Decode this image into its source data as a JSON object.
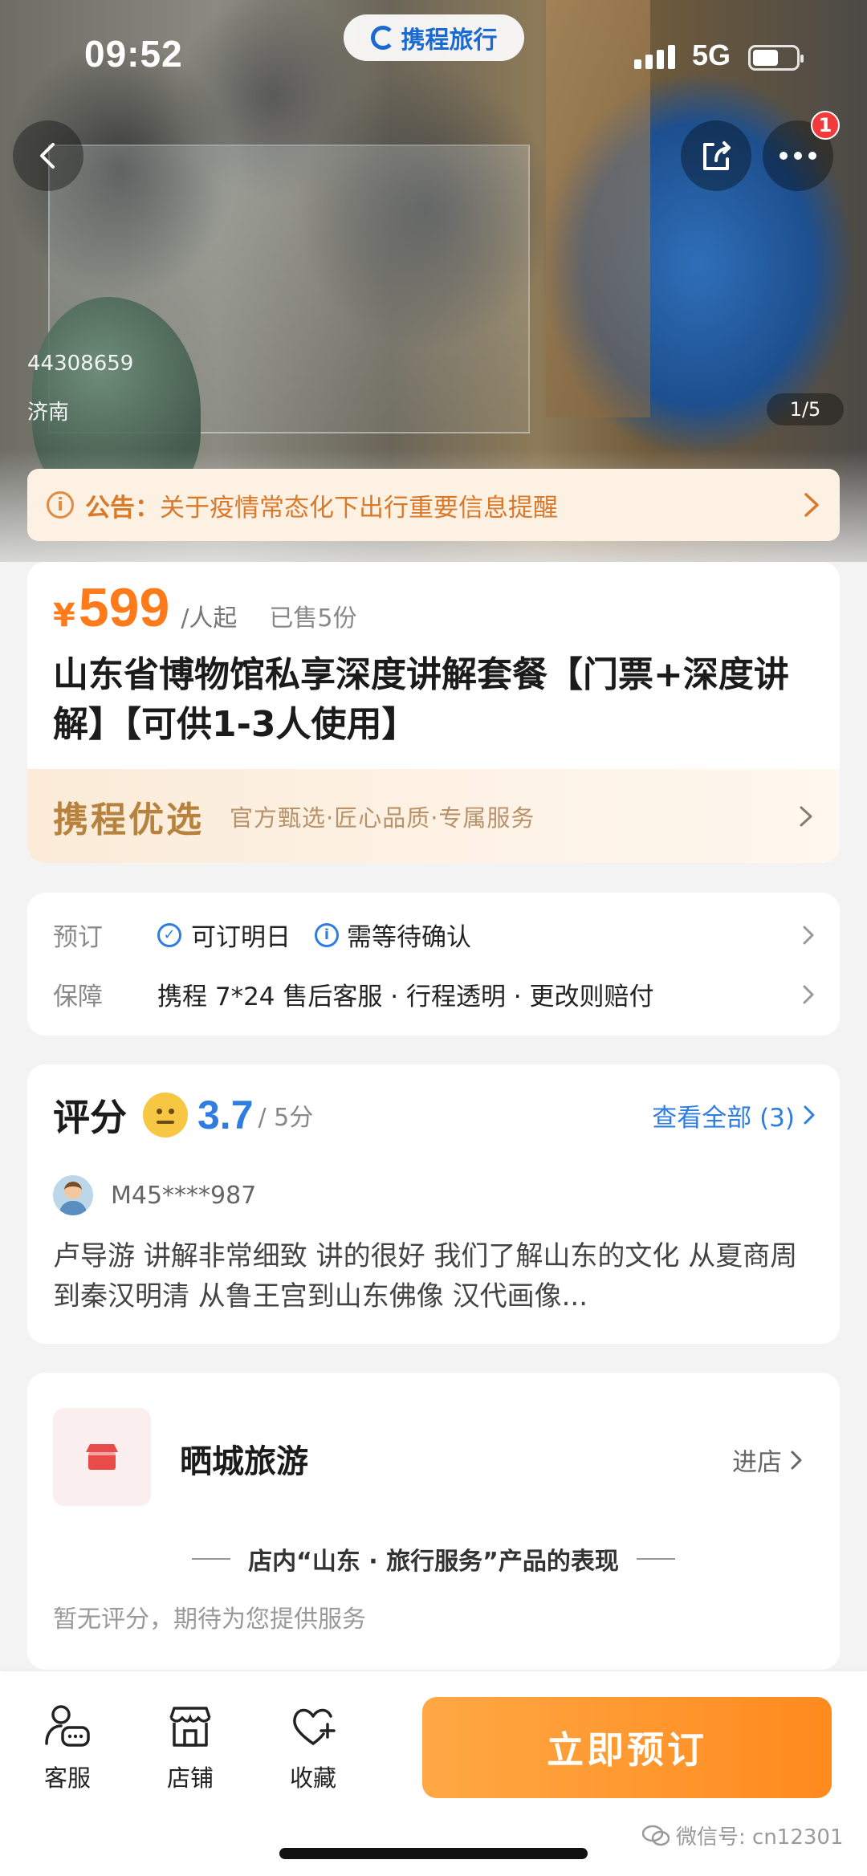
{
  "status_bar": {
    "time": "09:52",
    "network": "5G",
    "battery_level": 0.6
  },
  "app_brand": {
    "name": "携程旅行"
  },
  "hero": {
    "product_id": "44308659",
    "city": "济南",
    "photo_counter": "1/5",
    "notification_count": "1",
    "icons": {
      "back": "back-arrow-icon",
      "share": "share-icon",
      "more": "more-dots-icon"
    }
  },
  "notice": {
    "prefix": "公告：",
    "text": "关于疫情常态化下出行重要信息提醒"
  },
  "product": {
    "currency": "¥",
    "price": "599",
    "price_unit": "/人起",
    "sold": "已售5份",
    "title": "山东省博物馆私享深度讲解套餐【门票+深度讲解】【可供1-3人使用】",
    "select_logo": "携程优选",
    "select_slogan": "官方甄选·匠心品质·专属服务"
  },
  "booking": {
    "label": "预订",
    "bookable": "可订明日",
    "confirm": "需等待确认",
    "guarantee_label": "保障",
    "guarantee_text": "携程 7*24 售后客服 · 行程透明 · 更改则赔付"
  },
  "rating": {
    "title": "评分",
    "score": "3.7",
    "max": "/ 5分",
    "view_all": "查看全部 (3)",
    "reviewer": "M45****987",
    "review_text": "卢导游 讲解非常细致 讲的很好 我们了解山东的文化 从夏商周到秦汉明清 从鲁王宫到山东佛像 汉代画像..."
  },
  "shop": {
    "name": "晒城旅游",
    "enter": "进店",
    "section_title": "店内“山东 · 旅行服务”产品的表现",
    "empty_text": "暂无评分，期待为您提供服务"
  },
  "bottom_bar": {
    "service_label": "客服",
    "shop_label": "店铺",
    "favorite_label": "收藏",
    "book_label": "立即预订"
  },
  "watermark": "微信号: cn12301",
  "colors": {
    "accent_orange": "#ff8a1e",
    "link_blue": "#2f7de1",
    "notice_bg": "#fdf1e4"
  }
}
